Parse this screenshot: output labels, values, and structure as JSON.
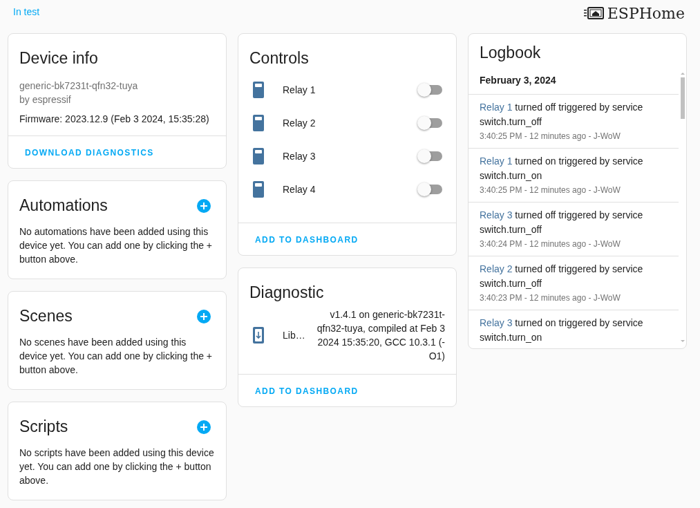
{
  "header": {
    "link": "In test",
    "logo_text": "ESPHome"
  },
  "device_info": {
    "title": "Device info",
    "model": "generic-bk7231t-qfn32-tuya",
    "manufacturer": "by espressif",
    "firmware": "Firmware: 2023.12.9 (Feb 3 2024, 15:35:28)",
    "action": "DOWNLOAD DIAGNOSTICS"
  },
  "related": [
    {
      "title": "Automations",
      "text": "No automations have been added using this device yet. You can add one by clicking the + button above."
    },
    {
      "title": "Scenes",
      "text": "No scenes have been added using this device yet. You can add one by clicking the + button above."
    },
    {
      "title": "Scripts",
      "text": "No scripts have been added using this device yet. You can add one by clicking the + button above."
    }
  ],
  "controls": {
    "title": "Controls",
    "action": "ADD TO DASHBOARD",
    "items": [
      {
        "name": "Relay 1",
        "on": false
      },
      {
        "name": "Relay 2",
        "on": false
      },
      {
        "name": "Relay 3",
        "on": false
      },
      {
        "name": "Relay 4",
        "on": false
      }
    ]
  },
  "diagnostic": {
    "title": "Diagnostic",
    "action": "ADD TO DASHBOARD",
    "items": [
      {
        "name": "Lib…",
        "value": "v1.4.1 on generic-bk7231t-qfn32-tuya, compiled at Feb 3 2024 15:35:20, GCC 10.3.1 (-O1)"
      }
    ]
  },
  "logbook": {
    "title": "Logbook",
    "date": "February 3, 2024",
    "entries": [
      {
        "entity": "Relay 1",
        "message": "turned off triggered by service switch.turn_off",
        "time": "3:40:25 PM - 12 minutes ago - J-WoW"
      },
      {
        "entity": "Relay 1",
        "message": "turned on triggered by service switch.turn_on",
        "time": "3:40:25 PM - 12 minutes ago - J-WoW"
      },
      {
        "entity": "Relay 3",
        "message": "turned off triggered by service switch.turn_off",
        "time": "3:40:24 PM - 12 minutes ago - J-WoW"
      },
      {
        "entity": "Relay 2",
        "message": "turned off triggered by service switch.turn_off",
        "time": "3:40:23 PM - 12 minutes ago - J-WoW"
      },
      {
        "entity": "Relay 3",
        "message": "turned on triggered by service switch.turn_on"
      }
    ]
  }
}
